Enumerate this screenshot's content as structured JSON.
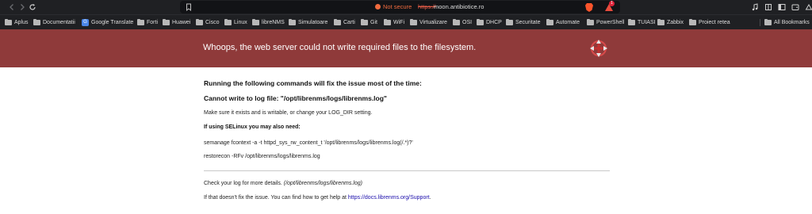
{
  "browser": {
    "url_warning": "Not secure",
    "url_protocol": "https://",
    "url_host": "moon.antibiotice.ro",
    "rewards_badge": "1"
  },
  "bookmarks": [
    {
      "label": "Aplus",
      "icon": "folder"
    },
    {
      "label": "Documentatii",
      "icon": "folder"
    },
    {
      "label": "Google Translate",
      "icon": "google-translate"
    },
    {
      "label": "Forti",
      "icon": "folder"
    },
    {
      "label": "Huawei",
      "icon": "folder"
    },
    {
      "label": "Cisco",
      "icon": "folder"
    },
    {
      "label": "Linux",
      "icon": "folder"
    },
    {
      "label": "libreNMS",
      "icon": "folder"
    },
    {
      "label": "Simulatoare",
      "icon": "folder"
    },
    {
      "label": "Carti",
      "icon": "folder"
    },
    {
      "label": "Git",
      "icon": "folder"
    },
    {
      "label": "WiFi",
      "icon": "folder"
    },
    {
      "label": "Virtualizare",
      "icon": "folder"
    },
    {
      "label": "OSI",
      "icon": "folder"
    },
    {
      "label": "DHCP",
      "icon": "folder"
    },
    {
      "label": "Securitate",
      "icon": "folder"
    },
    {
      "label": "Automate",
      "icon": "folder"
    },
    {
      "label": "PowerShell",
      "icon": "folder"
    },
    {
      "label": "TUIASI",
      "icon": "folder"
    },
    {
      "label": "Zabbix",
      "icon": "folder"
    },
    {
      "label": "Proiect retea",
      "icon": "folder"
    },
    {
      "label": "All Bookmarks",
      "icon": "folder"
    }
  ],
  "banner": {
    "title": "Whoops, the web server could not write required files to the filesystem.",
    "color": "#8f3a3a"
  },
  "content": {
    "heading": "Running the following commands will fix the issue most of the time:",
    "subheading": "Cannot write to log file: \"/opt/librenms/logs/librenms.log\"",
    "hint": "Make sure it exists and is writable, or change your LOG_DIR setting.",
    "selinux_heading": "If using SELinux you may also need:",
    "command1": "semanage fcontext -a -t httpd_sys_rw_content_t '/opt/librenms/logs/librenms.log(/.*)?'",
    "command2": "restorecon -RFv /opt/librenms/logs/librenms.log",
    "check_log_prefix": "Check your log for more details. ",
    "check_log_path": "(/opt/librenms/logs/librenms.log)",
    "help_prefix": "If that doesn't fix the issue. You can find how to get help at ",
    "help_link": "https://docs.librenms.org/Support",
    "help_suffix": "."
  }
}
